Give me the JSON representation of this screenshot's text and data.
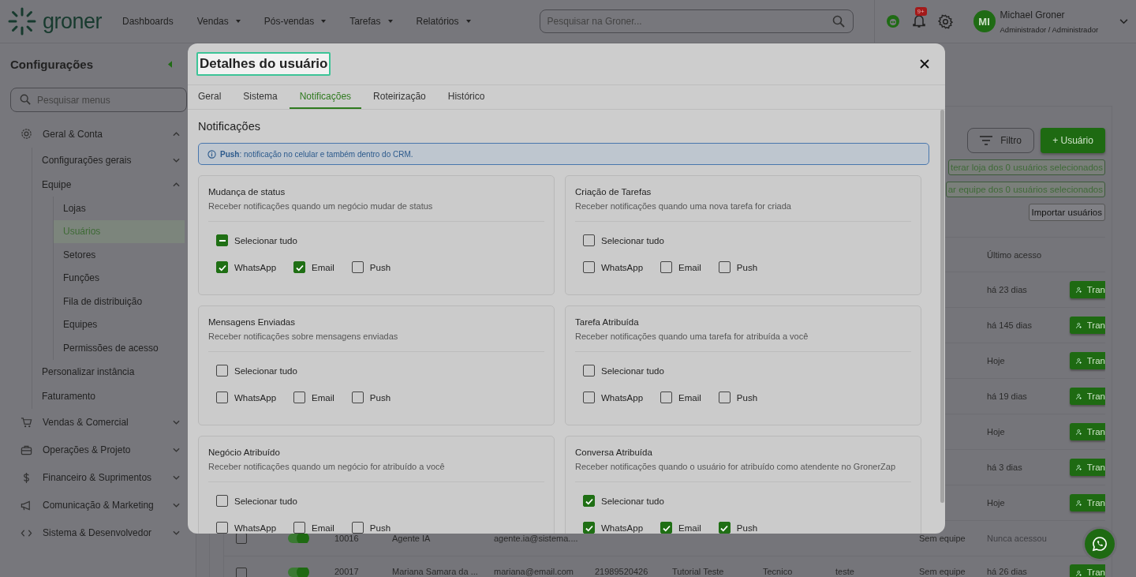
{
  "header": {
    "logo": "groner",
    "nav": [
      {
        "label": "Dashboards",
        "dropdown": false
      },
      {
        "label": "Vendas",
        "dropdown": true
      },
      {
        "label": "Pós-vendas",
        "dropdown": true
      },
      {
        "label": "Tarefas",
        "dropdown": true
      },
      {
        "label": "Relatórios",
        "dropdown": true
      }
    ],
    "search": {
      "placeholder": "Pesquisar na Groner..."
    },
    "notifications_badge": "9+",
    "user": {
      "initials": "MI",
      "name": "Michael Groner",
      "role": "Administrador / Administrador"
    }
  },
  "sidebar": {
    "title": "Configurações",
    "search": {
      "placeholder": "Pesquisar menus"
    },
    "items": [
      {
        "label": "Geral & Conta",
        "expanded": true,
        "selected": false,
        "children": [
          {
            "label": "Configurações gerais",
            "expanded": false,
            "selected": false
          },
          {
            "label": "Equipe",
            "expanded": true,
            "selected": false,
            "children": [
              {
                "label": "Lojas",
                "selected": false
              },
              {
                "label": "Usuários",
                "selected": true
              },
              {
                "label": "Setores",
                "selected": false
              },
              {
                "label": "Funções",
                "selected": false
              },
              {
                "label": "Fila de distribuição",
                "selected": false
              },
              {
                "label": "Equipes",
                "selected": false
              },
              {
                "label": "Permissões de acesso",
                "selected": false
              }
            ]
          },
          {
            "label": "Personalizar instância",
            "selected": false
          },
          {
            "label": "Faturamento",
            "selected": false
          }
        ]
      },
      {
        "label": "Vendas & Comercial",
        "expanded": false,
        "selected": false
      },
      {
        "label": "Operações & Projeto",
        "expanded": false,
        "selected": false
      },
      {
        "label": "Financeiro & Suprimentos",
        "expanded": false,
        "selected": false
      },
      {
        "label": "Comunicação & Marketing",
        "expanded": false,
        "selected": false
      },
      {
        "label": "Sistema & Desenvolvedor",
        "expanded": false,
        "selected": false
      }
    ]
  },
  "main": {
    "filter_button": "Filtro",
    "add_button": "+ Usuário",
    "bulk_buttons": [
      "terar loja dos 0 usuários selecionados",
      "ar equipe dos 0 usuários selecionados"
    ],
    "import_button": "Importar usuários",
    "table": {
      "columns": [
        "Último acesso"
      ],
      "rows": [
        {
          "last_access": "há 23 dias",
          "action": "Tran"
        },
        {
          "last_access": "há 145 dias",
          "action": "Tran"
        },
        {
          "last_access": "Hoje",
          "action": "Tran"
        },
        {
          "last_access": "há 19 dias",
          "action": "Tran"
        },
        {
          "last_access": "Hoje",
          "action": "Tran"
        },
        {
          "last_access": "há 3 dias",
          "action": "Tran"
        },
        {
          "last_access": "Hoje",
          "action": "Tran"
        },
        {
          "checked": false,
          "active": true,
          "id": "10016",
          "name": "Agente IA",
          "email": "agente.ia@sistema....",
          "team": "Sem equipe",
          "last_access": "Nunca acessou"
        },
        {
          "checked": false,
          "active": true,
          "id": "20017",
          "name": "Mariana Samara da ...",
          "email": "mariana@email.com",
          "phone": "21989520426",
          "store": "Tutorial Teste",
          "role": "Tecnico",
          "group": "teste",
          "team": "Sem equipe",
          "last_access": "há 26 dias",
          "action": "Tran"
        }
      ]
    }
  },
  "modal": {
    "title": "Detalhes do usuário",
    "tabs": [
      {
        "label": "Geral",
        "selected": false
      },
      {
        "label": "Sistema",
        "selected": false
      },
      {
        "label": "Notificações",
        "selected": true
      },
      {
        "label": "Roteirização",
        "selected": false
      },
      {
        "label": "Histórico",
        "selected": false
      }
    ],
    "heading": "Notificações",
    "info": "**Push**: notificação no celular e também dentro do CRM.",
    "cards": [
      {
        "title": "Mudança de status",
        "description": "Receber notificações quando um negócio mudar de status",
        "select_all": {
          "label": "Selecionar tudo",
          "checked": true,
          "indeterminate": true
        },
        "channels": [
          {
            "label": "WhatsApp",
            "checked": true
          },
          {
            "label": "Email",
            "checked": true
          },
          {
            "label": "Push",
            "checked": false
          }
        ]
      },
      {
        "title": "Criação de Tarefas",
        "description": "Receber notificações quando uma nova tarefa for criada",
        "select_all": {
          "label": "Selecionar tudo",
          "checked": false,
          "indeterminate": false
        },
        "channels": [
          {
            "label": "WhatsApp",
            "checked": false
          },
          {
            "label": "Email",
            "checked": false
          },
          {
            "label": "Push",
            "checked": false
          }
        ]
      },
      {
        "title": "Mensagens Enviadas",
        "description": "Receber notificações sobre mensagens enviadas",
        "select_all": {
          "label": "Selecionar tudo",
          "checked": false,
          "indeterminate": false
        },
        "channels": [
          {
            "label": "WhatsApp",
            "checked": false
          },
          {
            "label": "Email",
            "checked": false
          },
          {
            "label": "Push",
            "checked": false
          }
        ]
      },
      {
        "title": "Tarefa Atribuída",
        "description": "Receber notificações quando uma tarefa for atribuída a você",
        "select_all": {
          "label": "Selecionar tudo",
          "checked": false,
          "indeterminate": false
        },
        "channels": [
          {
            "label": "WhatsApp",
            "checked": false
          },
          {
            "label": "Email",
            "checked": false
          },
          {
            "label": "Push",
            "checked": false
          }
        ]
      },
      {
        "title": "Negócio Atribuído",
        "description": "Receber notificações quando um negócio for atribuído a você",
        "select_all": {
          "label": "Selecionar tudo",
          "checked": false,
          "indeterminate": false
        },
        "channels": [
          {
            "label": "WhatsApp",
            "checked": false
          },
          {
            "label": "Email",
            "checked": false
          },
          {
            "label": "Push",
            "checked": false
          }
        ]
      },
      {
        "title": "Conversa Atribuída",
        "description": "Receber notificações quando o usuário for atribuído como atendente no GronerZap",
        "select_all": {
          "label": "Selecionar tudo",
          "checked": true,
          "indeterminate": false
        },
        "channels": [
          {
            "label": "WhatsApp",
            "checked": true
          },
          {
            "label": "Email",
            "checked": true
          },
          {
            "label": "Push",
            "checked": true
          }
        ]
      }
    ]
  }
}
